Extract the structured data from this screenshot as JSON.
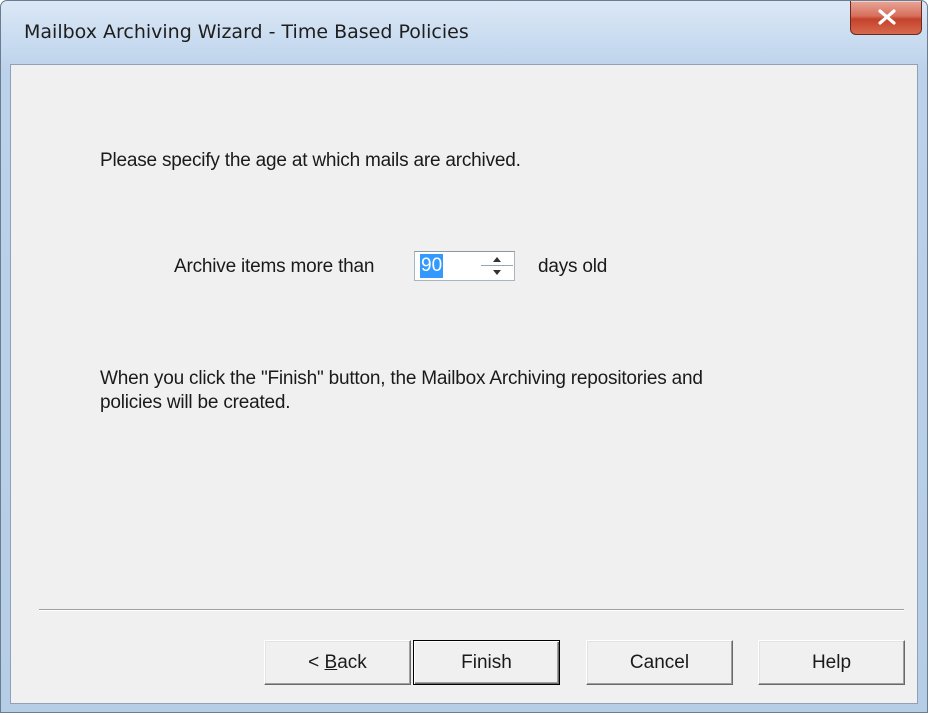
{
  "window": {
    "title": "Mailbox Archiving Wizard - Time Based Policies",
    "close_icon": "close-x-icon"
  },
  "content": {
    "prompt": "Please specify the age at which mails are archived.",
    "archive_label": "Archive items more than",
    "days_value": "90",
    "days_suffix": "days old",
    "info_line1": "When you click the \"Finish\" button, the Mailbox Archiving repositories and",
    "info_line2": "policies will be created."
  },
  "buttons": {
    "back_prefix": "< ",
    "back_mnemonic": "B",
    "back_rest": "ack",
    "finish": "Finish",
    "cancel": "Cancel",
    "help": "Help"
  },
  "colors": {
    "selection": "#3399ff",
    "close_button": "#c4422b",
    "client_background": "#f0f0f0"
  }
}
